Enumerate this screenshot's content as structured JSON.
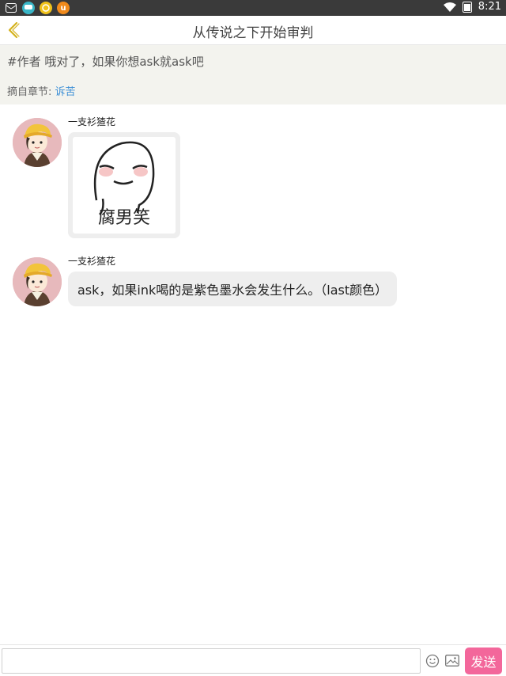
{
  "status_bar": {
    "time": "8:21",
    "left_icons": [
      "mail-icon",
      "chat-bubble-icon",
      "smile-app-icon",
      "u-app-icon"
    ],
    "u_icon_letter": "u"
  },
  "header": {
    "title": "从传说之下开始审判"
  },
  "quote": {
    "text": "#作者 哦对了，如果你想ask就ask吧",
    "chapter_prefix": "摘自章节:",
    "chapter_link": "诉苦"
  },
  "messages": [
    {
      "sender": "一支衫猹花",
      "type": "image",
      "image_caption": "腐男笑"
    },
    {
      "sender": "一支衫猹花",
      "type": "text",
      "text": "ask，如果ink喝的是紫色墨水会发生什么。（last颜色）"
    }
  ],
  "input": {
    "placeholder": "",
    "send_label": "发送"
  },
  "colors": {
    "send_button": "#f3679b",
    "link": "#3c8fd6",
    "quote_bg": "#f3f3ee",
    "avatar_bg": "#e7b9bc"
  }
}
